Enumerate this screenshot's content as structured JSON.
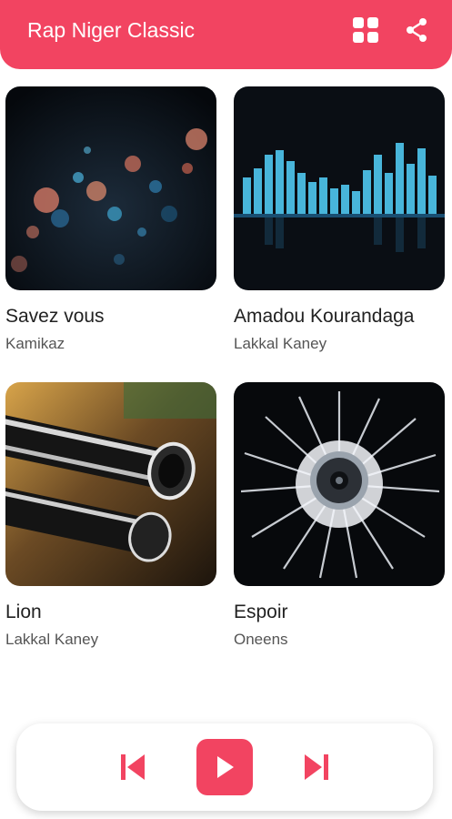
{
  "appbar": {
    "title": "Rap Niger Classic",
    "color": "#f24461",
    "icons": [
      "grid-view-icon",
      "share-icon"
    ]
  },
  "songs": [
    {
      "title": "Savez vous",
      "artist": "Kamikaz",
      "art": "bokeh-lights"
    },
    {
      "title": "Amadou Kourandaga",
      "artist": "Lakkal Kaney",
      "art": "equalizer-bars"
    },
    {
      "title": "Lion",
      "artist": "Lakkal Kaney",
      "art": "clarinet-instrument"
    },
    {
      "title": "Espoir",
      "artist": "Oneens",
      "art": "speaker-splash"
    }
  ],
  "player": {
    "controls": [
      "previous-icon",
      "play-icon",
      "next-icon"
    ],
    "accent": "#f24461"
  }
}
